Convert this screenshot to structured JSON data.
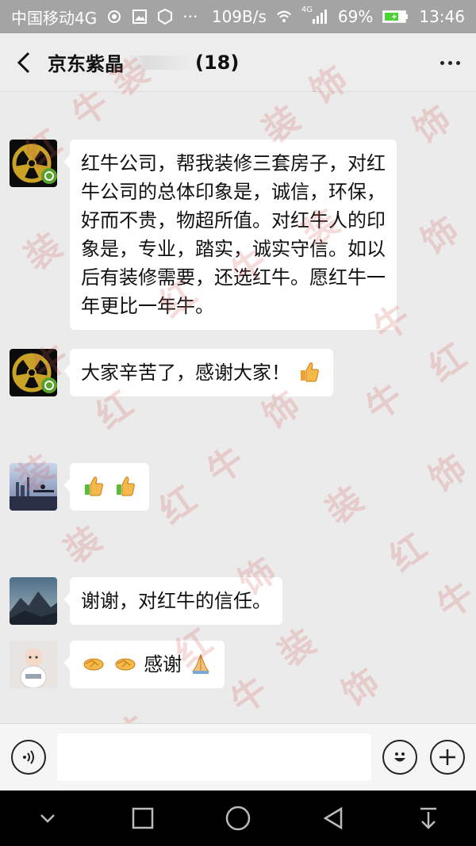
{
  "status": {
    "carrier": "中国移动4G",
    "speed": "109B/s",
    "signal": "4G",
    "battery": "69%",
    "time": "13:46"
  },
  "header": {
    "title": "京东紫晶",
    "count": "(18)"
  },
  "messages": [
    {
      "avatar": "avatar-logo",
      "text": "红牛公司，帮我装修三套房子，对红牛公司的总体印象是，诚信，环保，好而不贵，物超所值。对红牛人的印象是，专业，踏实，诚实守信。如以后有装修需要，还选红牛。愿红牛一年更比一年牛。"
    },
    {
      "avatar": "avatar-logo",
      "text": "大家辛苦了，感谢大家！",
      "emojis": [
        "thumbs-up"
      ]
    },
    {
      "avatar": "avatar-city",
      "text": "",
      "emojis": [
        "thumbs-up",
        "thumbs-up"
      ]
    },
    {
      "avatar": "avatar-mountain",
      "text": "谢谢，对红牛的信任。"
    },
    {
      "avatar": "avatar-baby",
      "text": "感谢",
      "emojis_before": [
        "handshake",
        "handshake"
      ],
      "emojis": [
        "pray"
      ]
    }
  ],
  "watermark": {
    "text": [
      "红",
      "牛",
      "装",
      "饰"
    ]
  },
  "input": {
    "placeholder": ""
  }
}
